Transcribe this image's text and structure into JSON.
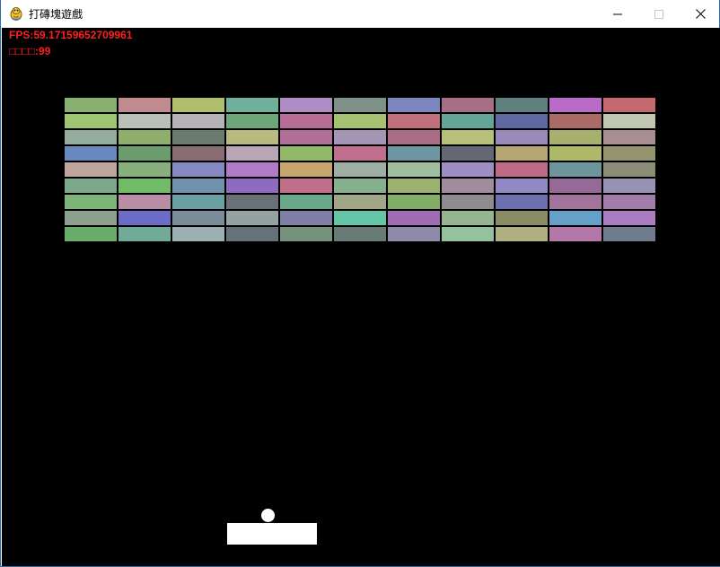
{
  "window": {
    "title": "打磚塊遊戲",
    "icon": "pygame-snake-icon"
  },
  "hud": {
    "fps_text": "FPS:59.17159652709961",
    "score_text": "□□□□:99",
    "color": "#ff2020"
  },
  "ball": {
    "color": "#ffffff"
  },
  "paddle": {
    "color": "#ffffff"
  },
  "bricks": {
    "rows": 9,
    "cols": 11,
    "colors": [
      [
        "#88b070",
        "#c08a8f",
        "#b1bf6c",
        "#70b09a",
        "#ae8cc4",
        "#7e928a",
        "#7c86c0",
        "#a86e85",
        "#5e817f",
        "#b86cc8",
        "#c46a6e"
      ],
      [
        "#9ec672",
        "#b8c0b8",
        "#b6b2b6",
        "#6ea67a",
        "#b66e96",
        "#a6c270",
        "#c0707a",
        "#64a696",
        "#6068a2",
        "#aa6a66",
        "#c0c6b0"
      ],
      [
        "#94ac9c",
        "#90ae6c",
        "#6a7c6e",
        "#b8ba80",
        "#b06e98",
        "#a696b6",
        "#aa6e84",
        "#b6c078",
        "#9a8ab8",
        "#a8b070",
        "#a88e92"
      ],
      [
        "#6a88c0",
        "#6a9c6c",
        "#8a6c74",
        "#b8a6b6",
        "#94b86a",
        "#c0708c",
        "#6e96a2",
        "#646874",
        "#b6a674",
        "#aeb868",
        "#94946e"
      ],
      [
        "#c0a69a",
        "#88b07c",
        "#8688c0",
        "#b07ac6",
        "#c6a66e",
        "#9eaea4",
        "#9ebe9e",
        "#9e8ec4",
        "#be6a86",
        "#6e949c",
        "#8a8c76"
      ],
      [
        "#7ea88a",
        "#70bc66",
        "#7092ae",
        "#8e6ac0",
        "#c06e8a",
        "#84b08e",
        "#9cb070",
        "#a08c9c",
        "#9288c4",
        "#966a96",
        "#9692b2"
      ],
      [
        "#7eb67a",
        "#ba8ea6",
        "#6aa0a2",
        "#687276",
        "#6aa88a",
        "#a0a686",
        "#82ae68",
        "#8e8c8e",
        "#6e70b2",
        "#a2749c",
        "#a47cac"
      ],
      [
        "#8ea08e",
        "#6a6cc6",
        "#7a8c9a",
        "#94a2a2",
        "#7e7ea6",
        "#64c6a6",
        "#a06cb4",
        "#94b492",
        "#8a8c66",
        "#66a0c8",
        "#aa7cc2"
      ],
      [
        "#6aac6a",
        "#70aa98",
        "#9cb0b4",
        "#66727a",
        "#76927c",
        "#687a76",
        "#8e8aac",
        "#94c29e",
        "#b0b080",
        "#b478a8",
        "#6e7c8e"
      ]
    ]
  }
}
